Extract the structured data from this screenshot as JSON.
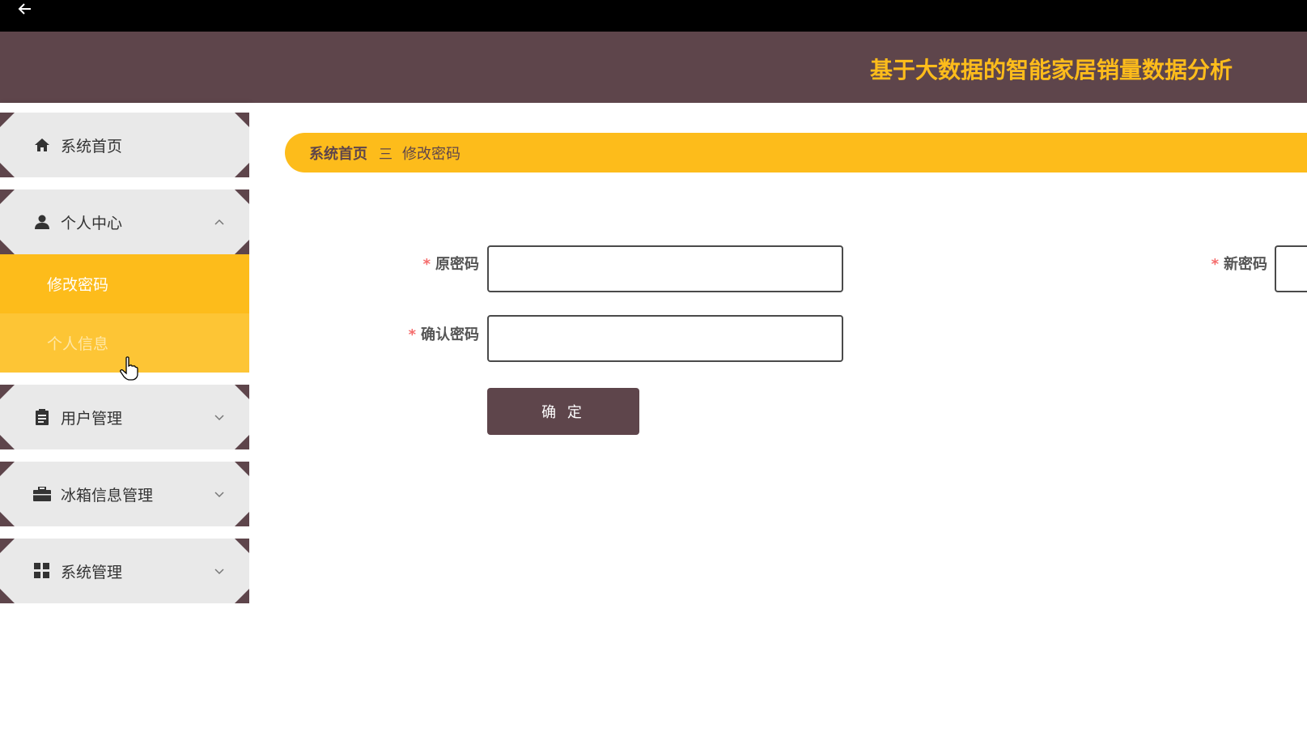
{
  "header": {
    "title": "基于大数据的智能家居销量数据分析"
  },
  "sidebar": {
    "items": [
      {
        "label": "系统首页",
        "icon": "home-icon"
      },
      {
        "label": "个人中心",
        "icon": "user-icon",
        "expanded": true,
        "children": [
          {
            "label": "修改密码",
            "active": true
          },
          {
            "label": "个人信息",
            "hovered": true
          }
        ]
      },
      {
        "label": "用户管理",
        "icon": "clipboard-icon"
      },
      {
        "label": "冰箱信息管理",
        "icon": "briefcase-icon"
      },
      {
        "label": "系统管理",
        "icon": "grid-icon"
      }
    ]
  },
  "breadcrumb": {
    "home": "系统首页",
    "separator": "三",
    "current": "修改密码"
  },
  "form": {
    "required_mark": "*",
    "old_password_label": "原密码",
    "new_password_label": "新密码",
    "confirm_password_label": "确认密码",
    "submit_label": "确 定"
  },
  "colors": {
    "brand_dark": "#5e454b",
    "accent": "#fdbc1b",
    "required": "#f56c6c"
  }
}
